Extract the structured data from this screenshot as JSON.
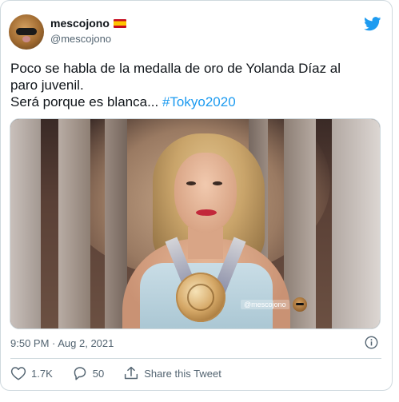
{
  "user": {
    "display_name": "mescojono",
    "handle": "@mescojono",
    "flag": "spain-flag"
  },
  "tweet": {
    "text_line1": "Poco se habla de la medalla de oro de Yolanda Díaz al",
    "text_line2": "paro juvenil.",
    "text_line3": "Será porque es blanca... ",
    "hashtag": "#Tokyo2020",
    "timestamp": "9:50 PM · Aug 2, 2021"
  },
  "media": {
    "watermark": "@mescojono"
  },
  "actions": {
    "likes": "1.7K",
    "replies": "50",
    "share_label": "Share this Tweet"
  },
  "icons": {
    "brand": "twitter-bird-icon",
    "info": "info-icon",
    "like": "heart-icon",
    "reply": "reply-icon",
    "share": "share-icon"
  },
  "colors": {
    "accent": "#1d9bf0",
    "muted_text": "#536471",
    "border": "#cfd9de"
  }
}
